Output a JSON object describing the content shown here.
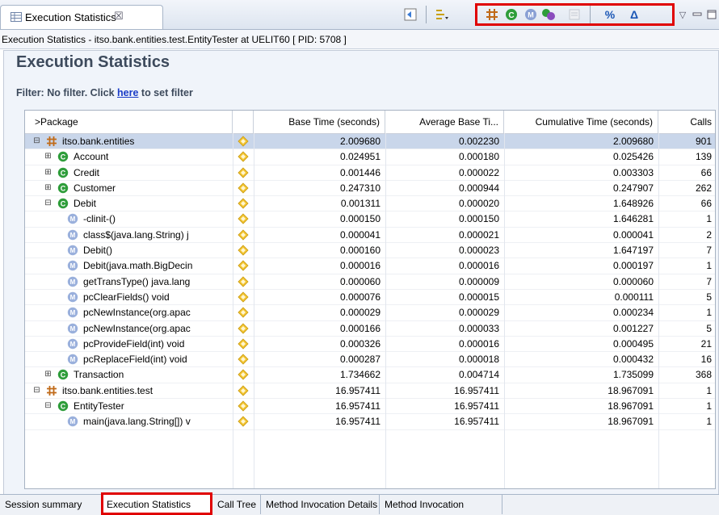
{
  "view_tab": {
    "title": "Execution Statistics",
    "close_glyph": "☒"
  },
  "status_line": "Execution Statistics - itso.bank.entities.test.EntityTester at UELIT60 [ PID: 5708 ]",
  "main": {
    "title": "Execution Statistics",
    "filter_prefix": "Filter: No filter. Click ",
    "filter_link": "here",
    "filter_suffix": " to set filter"
  },
  "toolbar": {
    "buttons": [
      "package-level-icon",
      "class-level-icon",
      "method-level-icon",
      "instance-level-icon",
      "show-as-percentage-icon",
      "delta-icon"
    ],
    "percent_label": "%",
    "delta_label": "Δ"
  },
  "table": {
    "columns": [
      "Package",
      "",
      "Base Time (seconds)",
      "Average Base Ti...",
      "Cumulative Time (seconds)",
      "Calls"
    ],
    "sort_prefix": ">",
    "rows": [
      {
        "level": 0,
        "type": "package",
        "toggle": "⊟",
        "name": "itso.bank.entities",
        "base": "2.009680",
        "avg": "0.002230",
        "cum": "2.009680",
        "calls": "901",
        "selected": true
      },
      {
        "level": 1,
        "type": "class",
        "toggle": "⊞",
        "name": "Account",
        "base": "0.024951",
        "avg": "0.000180",
        "cum": "0.025426",
        "calls": "139"
      },
      {
        "level": 1,
        "type": "class",
        "toggle": "⊞",
        "name": "Credit",
        "base": "0.001446",
        "avg": "0.000022",
        "cum": "0.003303",
        "calls": "66"
      },
      {
        "level": 1,
        "type": "class",
        "toggle": "⊞",
        "name": "Customer",
        "base": "0.247310",
        "avg": "0.000944",
        "cum": "0.247907",
        "calls": "262"
      },
      {
        "level": 1,
        "type": "class",
        "toggle": "⊟",
        "name": "Debit",
        "base": "0.001311",
        "avg": "0.000020",
        "cum": "1.648926",
        "calls": "66"
      },
      {
        "level": 2,
        "type": "method",
        "toggle": "",
        "name": "-clinit-()",
        "base": "0.000150",
        "avg": "0.000150",
        "cum": "1.646281",
        "calls": "1"
      },
      {
        "level": 2,
        "type": "method",
        "toggle": "",
        "name": "class$(java.lang.String) j",
        "base": "0.000041",
        "avg": "0.000021",
        "cum": "0.000041",
        "calls": "2"
      },
      {
        "level": 2,
        "type": "method",
        "toggle": "",
        "name": "Debit()",
        "base": "0.000160",
        "avg": "0.000023",
        "cum": "1.647197",
        "calls": "7"
      },
      {
        "level": 2,
        "type": "method",
        "toggle": "",
        "name": "Debit(java.math.BigDecin",
        "base": "0.000016",
        "avg": "0.000016",
        "cum": "0.000197",
        "calls": "1"
      },
      {
        "level": 2,
        "type": "method",
        "toggle": "",
        "name": "getTransType() java.lang",
        "base": "0.000060",
        "avg": "0.000009",
        "cum": "0.000060",
        "calls": "7"
      },
      {
        "level": 2,
        "type": "method",
        "toggle": "",
        "name": "pcClearFields() void",
        "base": "0.000076",
        "avg": "0.000015",
        "cum": "0.000111",
        "calls": "5"
      },
      {
        "level": 2,
        "type": "method",
        "toggle": "",
        "name": "pcNewInstance(org.apac",
        "base": "0.000029",
        "avg": "0.000029",
        "cum": "0.000234",
        "calls": "1"
      },
      {
        "level": 2,
        "type": "method",
        "toggle": "",
        "name": "pcNewInstance(org.apac",
        "base": "0.000166",
        "avg": "0.000033",
        "cum": "0.001227",
        "calls": "5"
      },
      {
        "level": 2,
        "type": "method",
        "toggle": "",
        "name": "pcProvideField(int) void",
        "base": "0.000326",
        "avg": "0.000016",
        "cum": "0.000495",
        "calls": "21"
      },
      {
        "level": 2,
        "type": "method",
        "toggle": "",
        "name": "pcReplaceField(int) void",
        "base": "0.000287",
        "avg": "0.000018",
        "cum": "0.000432",
        "calls": "16"
      },
      {
        "level": 1,
        "type": "class",
        "toggle": "⊞",
        "name": "Transaction",
        "base": "1.734662",
        "avg": "0.004714",
        "cum": "1.735099",
        "calls": "368"
      },
      {
        "level": 0,
        "type": "package",
        "toggle": "⊟",
        "name": "itso.bank.entities.test",
        "base": "16.957411",
        "avg": "16.957411",
        "cum": "18.967091",
        "calls": "1"
      },
      {
        "level": 1,
        "type": "class",
        "toggle": "⊟",
        "name": "EntityTester",
        "base": "16.957411",
        "avg": "16.957411",
        "cum": "18.967091",
        "calls": "1"
      },
      {
        "level": 2,
        "type": "method",
        "toggle": "",
        "name": "main(java.lang.String[]) v",
        "base": "16.957411",
        "avg": "16.957411",
        "cum": "18.967091",
        "calls": "1"
      }
    ]
  },
  "bottom_tabs": [
    {
      "label": "Session summary",
      "active": false
    },
    {
      "label": "Execution Statistics",
      "active": true
    },
    {
      "label": "Call Tree",
      "active": false
    },
    {
      "label": "Method Invocation Details",
      "active": false
    },
    {
      "label": "Method Invocation",
      "active": false
    }
  ],
  "colors": {
    "highlight_box": "#e00000",
    "class_icon": "#2e9d3a",
    "method_icon": "#9ab0dc",
    "package_icon": "#c06a18",
    "selected_row": "#c9d6ea"
  }
}
